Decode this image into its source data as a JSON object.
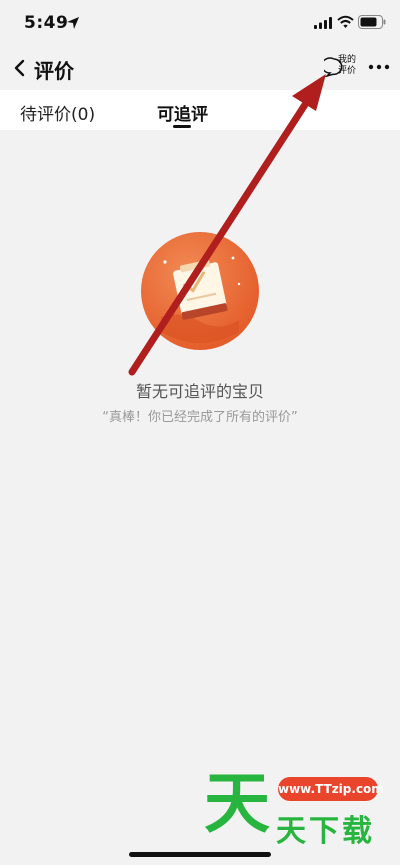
{
  "status_bar": {
    "time": "5:49"
  },
  "nav": {
    "title": "评价",
    "my_review_line1": "我的",
    "my_review_line2": "评价"
  },
  "tabs": [
    {
      "label": "待评价(0)",
      "selected": false
    },
    {
      "label": "可追评",
      "selected": true
    }
  ],
  "empty_state": {
    "title": "暂无可追评的宝贝",
    "subtitle": "“真棒！你已经完成了所有的评价”"
  },
  "watermark": {
    "big": "天",
    "url": "www.TTzip.com",
    "text": "天下载"
  },
  "colors": {
    "background": "#f2f2f2",
    "annotation_arrow": "#b01e1e",
    "illustration": "#e8652f",
    "watermark_green": "#27b53f",
    "watermark_red": "#e8452c"
  }
}
